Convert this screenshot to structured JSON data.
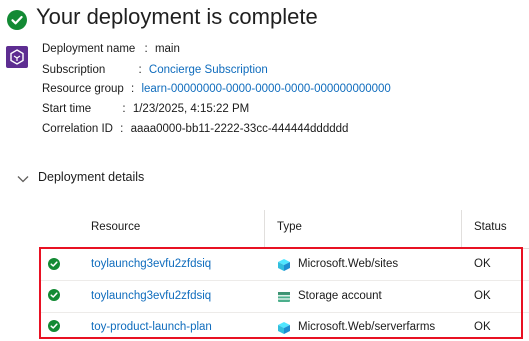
{
  "header": {
    "title": "Your deployment is complete",
    "status": "success"
  },
  "info": [
    {
      "key": "deployment_name",
      "label": "Deployment name",
      "sep": ":",
      "value": "main",
      "is_link": false
    },
    {
      "key": "subscription",
      "label": "Subscription",
      "sep": ":",
      "value": "Concierge Subscription",
      "is_link": true
    },
    {
      "key": "resource_group",
      "label": "Resource group",
      "sep": ":",
      "value": "learn-00000000-0000-0000-0000-000000000000",
      "is_link": true
    },
    {
      "key": "start_time",
      "label": "Start time",
      "sep": ":",
      "value": "1/23/2025, 4:15:22 PM",
      "is_link": false
    },
    {
      "key": "correlation_id",
      "label": "Correlation ID",
      "sep": ":",
      "value": "aaaa0000-bb11-2222-33cc-444444dddddd",
      "is_link": false
    }
  ],
  "details": {
    "label": "Deployment details",
    "columns": {
      "resource": "Resource",
      "type": "Type",
      "status": "Status"
    },
    "rows": [
      {
        "resource": "toylaunchg3evfu2zfdsiq",
        "type": "Microsoft.Web/sites",
        "type_icon": "cube-icon",
        "status": "OK"
      },
      {
        "resource": "toylaunchg3evfu2zfdsiq",
        "type": "Storage account",
        "type_icon": "storage-icon",
        "status": "OK"
      },
      {
        "resource": "toy-product-launch-plan",
        "type": "Microsoft.Web/serverfarms",
        "type_icon": "cube-icon",
        "status": "OK"
      }
    ]
  },
  "colors": {
    "success": "#138a34",
    "link": "#0f6cbd",
    "highlight": "#e81123",
    "deployment_icon": "#5d2d91"
  }
}
